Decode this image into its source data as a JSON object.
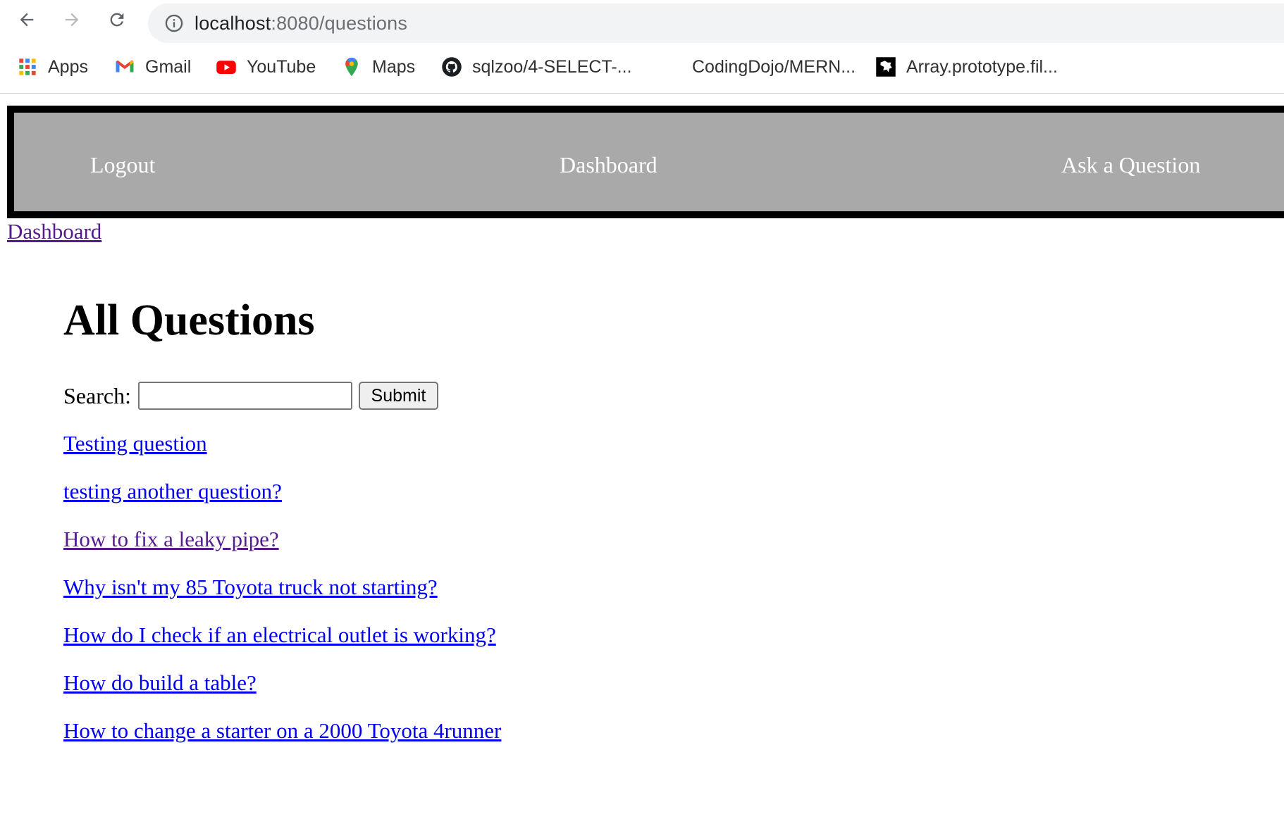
{
  "browser": {
    "url_host": "localhost",
    "url_path": ":8080/questions",
    "bookmarks": [
      {
        "label": "Apps",
        "icon": "apps-grid-icon"
      },
      {
        "label": "Gmail",
        "icon": "gmail-icon"
      },
      {
        "label": "YouTube",
        "icon": "youtube-icon"
      },
      {
        "label": "Maps",
        "icon": "maps-pin-icon"
      },
      {
        "label": "sqlzoo/4-SELECT-...",
        "icon": "github-icon"
      },
      {
        "label": "CodingDojo/MERN...",
        "icon": ""
      },
      {
        "label": "Array.prototype.fil...",
        "icon": "mdn-icon"
      }
    ]
  },
  "nav": {
    "logout": "Logout",
    "dashboard": "Dashboard",
    "ask": "Ask a Question",
    "background": "#a9a9a9",
    "border": "#000000"
  },
  "breadcrumb": {
    "label": "Dashboard"
  },
  "main": {
    "title": "All Questions",
    "search_label": "Search:",
    "search_value": "",
    "submit_label": "Submit",
    "questions": [
      {
        "title": "Testing question",
        "visited": false
      },
      {
        "title": "testing another question?",
        "visited": false
      },
      {
        "title": "How to fix a leaky pipe?",
        "visited": true
      },
      {
        "title": "Why isn't my 85 Toyota truck not starting?",
        "visited": false
      },
      {
        "title": "How do I check if an electrical outlet is working?",
        "visited": false
      },
      {
        "title": "How do build a table?",
        "visited": false
      },
      {
        "title": "How to change a starter on a 2000 Toyota 4runner",
        "visited": false
      }
    ]
  },
  "colors": {
    "link": "#0000ee",
    "visited_link": "#551a8b"
  }
}
